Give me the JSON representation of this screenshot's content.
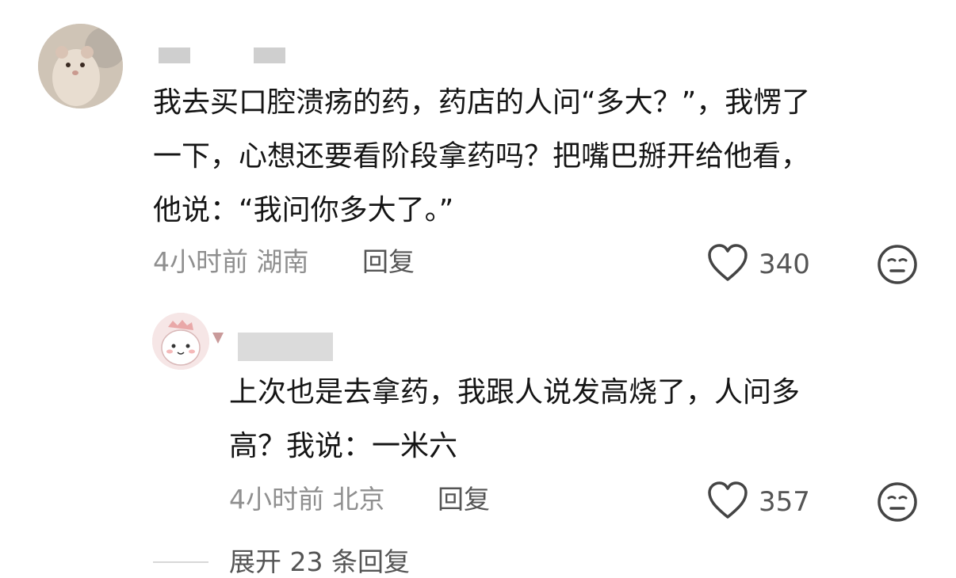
{
  "comment": {
    "lines": [
      "我去买口腔溃疡的药，药店的人问“多大？”，我愣了",
      "一下，心想还要看阶段拿药吗？把嘴巴掰开给他看，",
      "他说：“我问你多大了。”"
    ],
    "time": "4小时前",
    "location": "湖南",
    "reply_label": "回复",
    "like_count": "340",
    "like_icon": "heart-outline-icon",
    "dislike_icon": "meh-face-icon"
  },
  "reply": {
    "lines": [
      "上次也是去拿药，我跟人说发高烧了，人问多",
      "高？我说：一米六"
    ],
    "time": "4小时前",
    "location": "北京",
    "reply_label": "回复",
    "like_count": "357",
    "like_icon": "heart-outline-icon",
    "dislike_icon": "meh-face-icon"
  },
  "expand_label": "展开 23 条回复",
  "colors": {
    "text": "#151515",
    "meta": "#8f8f8f",
    "action": "#555555"
  }
}
